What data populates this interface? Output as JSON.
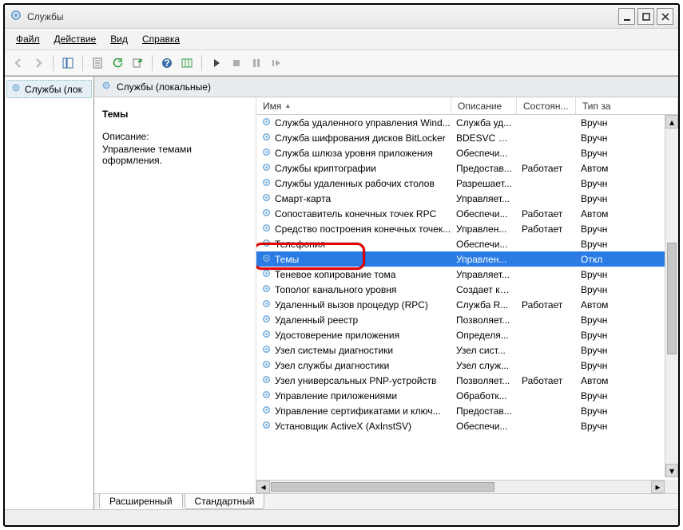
{
  "window": {
    "title": "Службы"
  },
  "menu": {
    "file": "Файл",
    "action": "Действие",
    "view": "Вид",
    "help": "Справка"
  },
  "tree": {
    "root": "Службы (лок"
  },
  "pane_header": "Службы (локальные)",
  "detail": {
    "selected_name": "Темы",
    "desc_label": "Описание:",
    "desc_text": "Управление темами оформления."
  },
  "columns": {
    "name": "Имя",
    "desc": "Описание",
    "state": "Состоян...",
    "type": "Тип за"
  },
  "services": [
    {
      "name": "Служба удаленного управления Wind...",
      "desc": "Служба уд...",
      "state": "",
      "type": "Вручн"
    },
    {
      "name": "Служба шифрования дисков BitLocker",
      "desc": "BDESVC пр...",
      "state": "",
      "type": "Вручн"
    },
    {
      "name": "Служба шлюза уровня приложения",
      "desc": "Обеспечи...",
      "state": "",
      "type": "Вручн"
    },
    {
      "name": "Службы криптографии",
      "desc": "Предостав...",
      "state": "Работает",
      "type": "Автом"
    },
    {
      "name": "Службы удаленных рабочих столов",
      "desc": "Разрешает...",
      "state": "",
      "type": "Вручн"
    },
    {
      "name": "Смарт-карта",
      "desc": "Управляет...",
      "state": "",
      "type": "Вручн"
    },
    {
      "name": "Сопоставитель конечных точек RPC",
      "desc": "Обеспечи...",
      "state": "Работает",
      "type": "Автом"
    },
    {
      "name": "Средство построения конечных точек...",
      "desc": "Управлен...",
      "state": "Работает",
      "type": "Вручн"
    },
    {
      "name": "Телефония",
      "desc": "Обеспечи...",
      "state": "",
      "type": "Вручн"
    },
    {
      "name": "Темы",
      "desc": "Управлен...",
      "state": "",
      "type": "Откл",
      "selected": true
    },
    {
      "name": "Теневое копирование тома",
      "desc": "Управляет...",
      "state": "",
      "type": "Вручн"
    },
    {
      "name": "Тополог канального уровня",
      "desc": "Создает ка...",
      "state": "",
      "type": "Вручн"
    },
    {
      "name": "Удаленный вызов процедур (RPC)",
      "desc": "Служба R...",
      "state": "Работает",
      "type": "Автом"
    },
    {
      "name": "Удаленный реестр",
      "desc": "Позволяет...",
      "state": "",
      "type": "Вручн"
    },
    {
      "name": "Удостоверение приложения",
      "desc": "Определя...",
      "state": "",
      "type": "Вручн"
    },
    {
      "name": "Узел системы диагностики",
      "desc": "Узел сист...",
      "state": "",
      "type": "Вручн"
    },
    {
      "name": "Узел службы диагностики",
      "desc": "Узел служ...",
      "state": "",
      "type": "Вручн"
    },
    {
      "name": "Узел универсальных PNP-устройств",
      "desc": "Позволяет...",
      "state": "Работает",
      "type": "Автом"
    },
    {
      "name": "Управление приложениями",
      "desc": "Обработк...",
      "state": "",
      "type": "Вручн"
    },
    {
      "name": "Управление сертификатами и ключ...",
      "desc": "Предостав...",
      "state": "",
      "type": "Вручн"
    },
    {
      "name": "Установщик ActiveX (AxInstSV)",
      "desc": "Обеспечи...",
      "state": "",
      "type": "Вручн"
    }
  ],
  "tabs": {
    "extended": "Расширенный",
    "standard": "Стандартный"
  }
}
